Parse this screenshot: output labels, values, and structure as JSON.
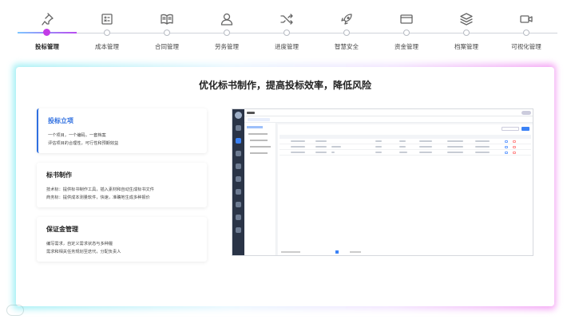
{
  "nav": {
    "items": [
      {
        "label": "投标管理",
        "icon": "pin-icon",
        "active": true
      },
      {
        "label": "成本管理",
        "icon": "calculator-icon",
        "active": false
      },
      {
        "label": "合同管理",
        "icon": "book-icon",
        "active": false
      },
      {
        "label": "劳务管理",
        "icon": "person-icon",
        "active": false
      },
      {
        "label": "进度管理",
        "icon": "shuffle-icon",
        "active": false
      },
      {
        "label": "智慧安全",
        "icon": "rocket-icon",
        "active": false
      },
      {
        "label": "资金管理",
        "icon": "card-icon",
        "active": false
      },
      {
        "label": "档案管理",
        "icon": "layers-icon",
        "active": false
      },
      {
        "label": "可视化管理",
        "icon": "video-icon",
        "active": false
      }
    ]
  },
  "content": {
    "headline": "优化标书制作，提高投标效率，降低风险",
    "features": [
      {
        "title": "投标立项",
        "lines": [
          "一个项目，一个编码，一套档案",
          "评估项目的合理性，可行性和预期效益"
        ]
      },
      {
        "title": "标书制作",
        "lines": [
          "技术标：提供标书制作工具，插入素材和自动生成标书文件",
          "商务标：提供成本测量软件，快速，准确地生成多种报价"
        ]
      },
      {
        "title": "保证金管理",
        "lines": [
          "编写需求，自定义需求状态与多种履",
          "需求和相关任务规划至迭代，分配负责人"
        ]
      }
    ]
  },
  "colors": {
    "accent": "#c23be6",
    "primary": "#2f6fe0"
  }
}
